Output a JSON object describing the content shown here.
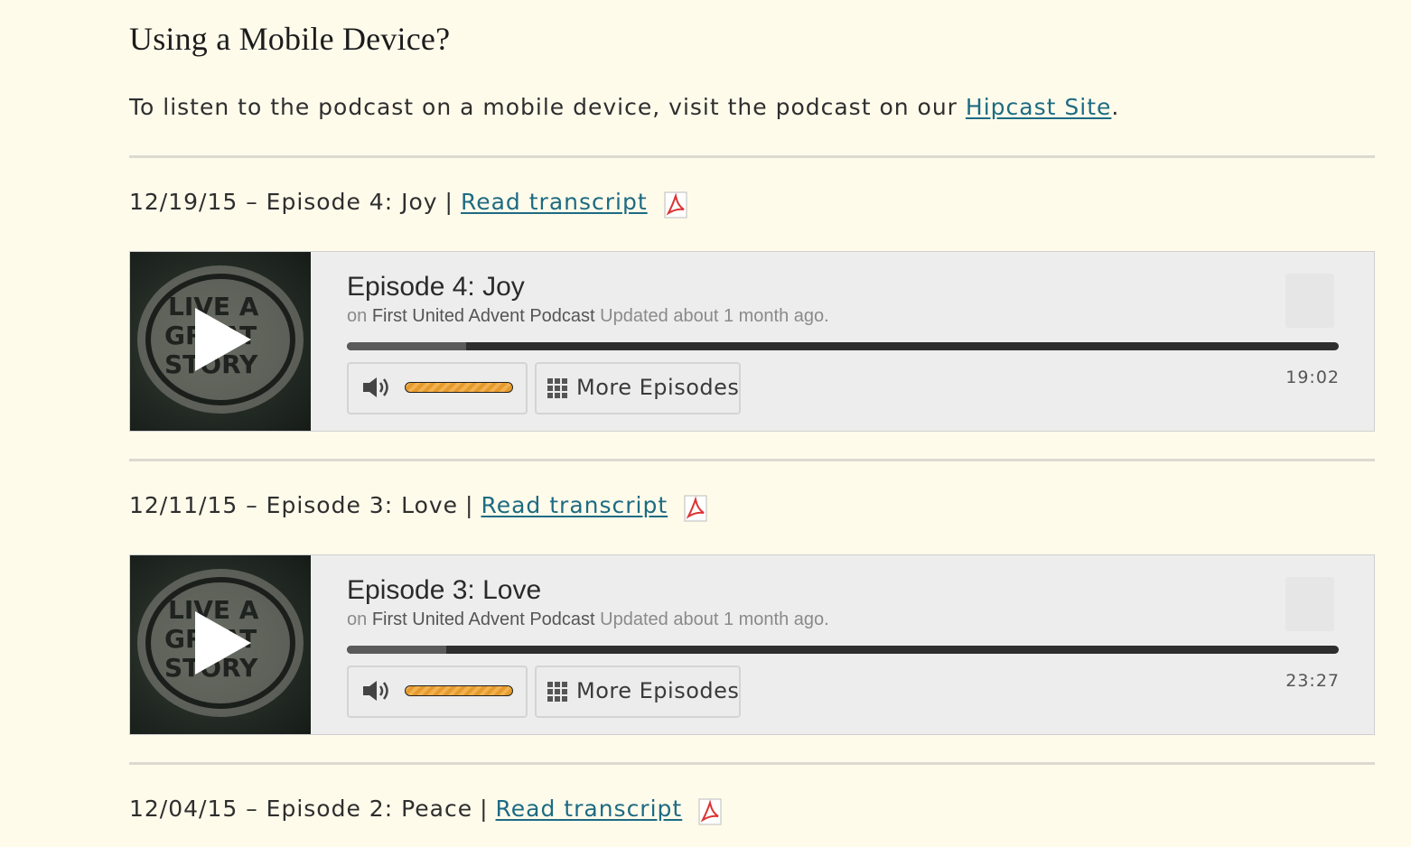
{
  "mobile": {
    "heading": "Using a Mobile Device?",
    "text_before": "To listen to the podcast on a mobile device, visit the podcast on our ",
    "link_label": "Hipcast Site",
    "text_after": "."
  },
  "episodes": [
    {
      "date_title": "12/19/15 – Episode 4: Joy",
      "separator": "|",
      "transcript_label": "Read transcript",
      "player": {
        "title": "Episode 4: Joy",
        "on_label": "on",
        "show": "First United Advent Podcast",
        "updated": "Updated about 1 month ago.",
        "duration": "19:02",
        "progress": 0.12,
        "more_label": "More Episodes",
        "artwork_text": [
          "LIVE A",
          "GREAT",
          "STORY"
        ]
      }
    },
    {
      "date_title": "12/11/15 – Episode 3: Love",
      "separator": "|",
      "transcript_label": "Read transcript",
      "player": {
        "title": "Episode 3: Love",
        "on_label": "on",
        "show": "First United Advent Podcast",
        "updated": "Updated about 1 month ago.",
        "duration": "23:27",
        "progress": 0.1,
        "more_label": "More Episodes",
        "artwork_text": [
          "LIVE A",
          "GREAT",
          "STORY"
        ]
      }
    },
    {
      "date_title": "12/04/15 – Episode 2: Peace",
      "separator": "|",
      "transcript_label": "Read transcript"
    }
  ],
  "colors": {
    "background": "#fffbeb",
    "link": "#1d6b83",
    "volume": "#f2b150"
  },
  "icons": [
    "pdf-icon",
    "play-icon",
    "speaker-icon",
    "grid-icon"
  ]
}
